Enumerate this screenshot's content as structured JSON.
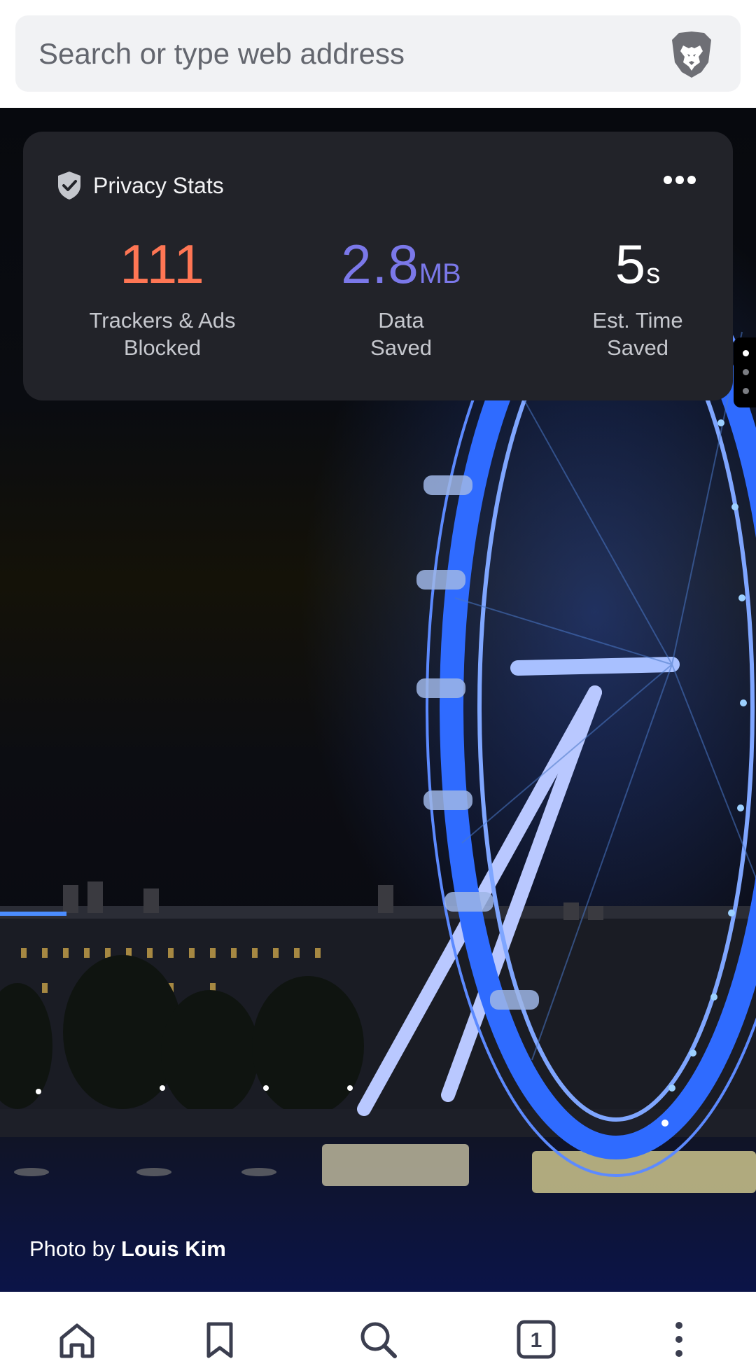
{
  "url_bar": {
    "placeholder": "Search or type web address",
    "brand_icon": "brave-lion-icon"
  },
  "privacy_stats": {
    "title": "Privacy Stats",
    "title_icon": "shield-check-icon",
    "menu_icon": "more-horizontal-icon",
    "trackers": {
      "value": "111",
      "label_line1": "Trackers & Ads",
      "label_line2": "Blocked",
      "color": "#ff7654"
    },
    "data_saved": {
      "value": "2.8",
      "unit": "MB",
      "label_line1": "Data",
      "label_line2": "Saved",
      "color": "#7b78e9"
    },
    "time_saved": {
      "value": "5",
      "unit": "s",
      "label_line1": "Est. Time",
      "label_line2": "Saved",
      "color": "#ffffff"
    }
  },
  "page_indicator": {
    "count": 3,
    "active_index": 0
  },
  "background": {
    "credit_prefix": "Photo by",
    "credit_author": "Louis Kim"
  },
  "toolbar": {
    "items": [
      {
        "icon": "home-icon"
      },
      {
        "icon": "bookmark-icon"
      },
      {
        "icon": "search-icon"
      },
      {
        "icon": "tabs-icon",
        "count": "1"
      },
      {
        "icon": "more-vertical-icon"
      }
    ]
  },
  "colors": {
    "accent_orange": "#ff7654",
    "accent_purple": "#7b78e9",
    "card_bg": "#222329",
    "toolbar_icon": "#3b3e4f"
  }
}
